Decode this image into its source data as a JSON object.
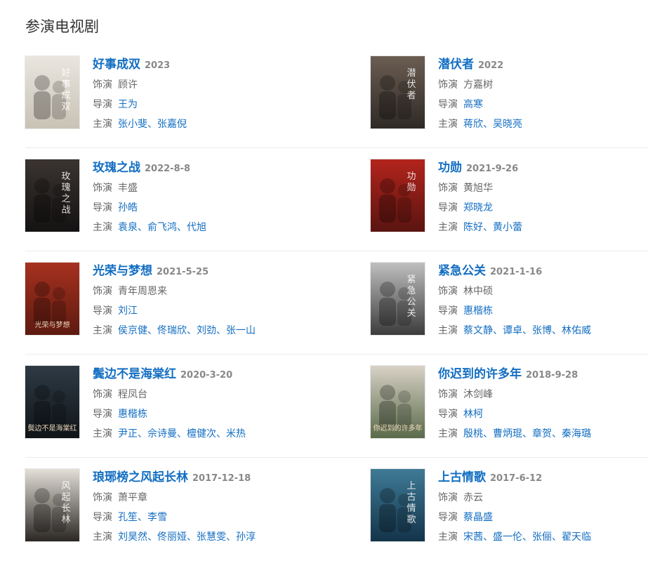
{
  "section": {
    "title": "参演电视剧"
  },
  "labels": {
    "role": "饰演",
    "director": "导演",
    "cast": "主演"
  },
  "entries": [
    {
      "title": "好事成双",
      "year": "2023",
      "role": "顾许",
      "director": [
        "王为"
      ],
      "cast": [
        "张小斐",
        "张嘉倪"
      ],
      "poster_text": "好事成双",
      "poster_colors": [
        "#e9e6df",
        "#c9c2b5"
      ]
    },
    {
      "title": "潜伏者",
      "year": "2022",
      "role": "方嘉树",
      "director": [
        "高寒"
      ],
      "cast": [
        "蒋欣",
        "吴晓亮"
      ],
      "poster_text": "潜伏者",
      "poster_colors": [
        "#6b5d52",
        "#2f2a26"
      ]
    },
    {
      "title": "玫瑰之战",
      "year": "2022-8-8",
      "role": "丰盛",
      "director": [
        "孙皓"
      ],
      "cast": [
        "袁泉",
        "俞飞鸿",
        "代旭"
      ],
      "poster_text": "玫瑰之战",
      "poster_colors": [
        "#3a3431",
        "#141212"
      ]
    },
    {
      "title": "功勋",
      "year": "2021-9-26",
      "role": "黄旭华",
      "director": [
        "郑晓龙"
      ],
      "cast": [
        "陈好",
        "黄小蕾"
      ],
      "poster_text": "功勋",
      "poster_colors": [
        "#b3241c",
        "#5a1410"
      ]
    },
    {
      "title": "光荣与梦想",
      "year": "2021-5-25",
      "role": "青年周恩来",
      "director": [
        "刘江"
      ],
      "cast": [
        "侯京健",
        "佟瑞欣",
        "刘劲",
        "张一山"
      ],
      "poster_text": "光荣与梦想",
      "poster_colors": [
        "#a6311f",
        "#5e1a10"
      ]
    },
    {
      "title": "紧急公关",
      "year": "2021-1-16",
      "role": "林中硕",
      "director": [
        "惠楷栋"
      ],
      "cast": [
        "蔡文静",
        "谭卓",
        "张博",
        "林佑威"
      ],
      "poster_text": "紧急公关",
      "poster_colors": [
        "#bfbfbf",
        "#3c3c3c"
      ]
    },
    {
      "title": "鬓边不是海棠红",
      "year": "2020-3-20",
      "role": "程凤台",
      "director": [
        "惠楷栋"
      ],
      "cast": [
        "尹正",
        "佘诗曼",
        "檀健次",
        "米热"
      ],
      "poster_text": "鬓边不是海棠红",
      "poster_colors": [
        "#2e3a44",
        "#0f1519"
      ]
    },
    {
      "title": "你迟到的许多年",
      "year": "2018-9-28",
      "role": "沐剑峰",
      "director": [
        "林柯"
      ],
      "cast": [
        "殷桃",
        "曹炳琨",
        "章贺",
        "秦海璐"
      ],
      "poster_text": "你迟到的许多年",
      "poster_colors": [
        "#d8d2c6",
        "#5a6b4a"
      ]
    },
    {
      "title": "琅琊榜之风起长林",
      "year": "2017-12-18",
      "role": "萧平章",
      "director": [
        "孔笙",
        "李雪"
      ],
      "cast": [
        "刘昊然",
        "佟丽娅",
        "张慧雯",
        "孙淳"
      ],
      "poster_text": "风起长林",
      "poster_colors": [
        "#e4e0d8",
        "#2a2724"
      ]
    },
    {
      "title": "上古情歌",
      "year": "2017-6-12",
      "role": "赤云",
      "director": [
        "蔡晶盛"
      ],
      "cast": [
        "宋茜",
        "盛一伦",
        "张俪",
        "翟天临"
      ],
      "poster_text": "上古情歌",
      "poster_colors": [
        "#3f7a96",
        "#13344a"
      ]
    }
  ]
}
